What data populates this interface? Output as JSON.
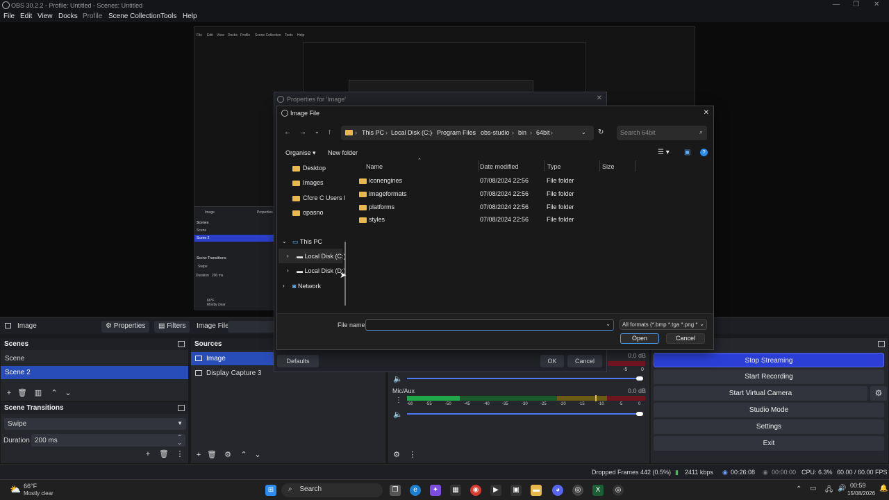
{
  "window": {
    "title": "OBS 30.2.2 - Profile: Untitled - Scenes: Untitled",
    "minimize": "—",
    "maximize": "❐",
    "close": "✕"
  },
  "menu": [
    "File",
    "Edit",
    "View",
    "Docks",
    "Profile",
    "Scene Collection",
    "Tools",
    "Help"
  ],
  "nested_preview": {
    "menu": [
      "File",
      "Edit",
      "View",
      "Docks",
      "Profile",
      "Scene Collection",
      "Tools",
      "Help"
    ],
    "sidebar": {
      "source": "Image",
      "properties": "Properties",
      "scenes_header": "Scenes",
      "scene1": "Scene",
      "scene2": "Scene 2",
      "transitions_header": "Scene Transitions",
      "transition": "Swipe",
      "duration": "Duration",
      "duration_value": "200 ms",
      "weather_temp": "66°F",
      "weather_cond": "Mostly clear"
    }
  },
  "source_toolbar": {
    "source_name": "Image",
    "properties": "Properties",
    "filters": "Filters",
    "image_file": "Image File"
  },
  "scenes": {
    "header": "Scenes",
    "items": [
      "Scene",
      "Scene 2"
    ]
  },
  "sources": {
    "header": "Sources",
    "items": [
      "Image",
      "Display Capture 3"
    ]
  },
  "transitions": {
    "header": "Scene Transitions",
    "type": "Swipe",
    "duration_label": "Duration",
    "duration_value": "200 ms"
  },
  "mixer": {
    "channel1_db": "0.0 dB",
    "channel2_name": "Mic/Aux",
    "channel2_db": "0.0 dB",
    "ticks": [
      "-60",
      "-55",
      "-50",
      "-45",
      "-40",
      "-35",
      "-30",
      "-25",
      "-20",
      "-15",
      "-10",
      "-5",
      "0"
    ],
    "ch1_ticks": [
      "-5",
      "0"
    ]
  },
  "controls": {
    "stop_streaming": "Stop Streaming",
    "start_recording": "Start Recording",
    "start_virtual_camera": "Start Virtual Camera",
    "studio_mode": "Studio Mode",
    "settings": "Settings",
    "exit": "Exit"
  },
  "status": {
    "dropped_frames": "Dropped Frames 442 (0.5%)",
    "bitrate": "2411 kbps",
    "stream_time": "00:26:08",
    "rec_time": "00:00:00",
    "cpu": "CPU: 6.3%",
    "fps": "60.00 / 60.00 FPS"
  },
  "properties_dialog": {
    "title": "Properties for 'Image'",
    "defaults": "Defaults",
    "ok": "OK",
    "cancel": "Cancel"
  },
  "file_dialog": {
    "title": "Image File",
    "breadcrumb": [
      "This PC",
      "Local Disk (C:)",
      "Program Files",
      "obs-studio",
      "bin",
      "64bit"
    ],
    "search_placeholder": "Search 64bit",
    "organise": "Organise",
    "new_folder": "New folder",
    "nav_items": [
      "Desktop",
      "Images",
      "Cfcre C Users l",
      "opasno"
    ],
    "this_pc": "This PC",
    "drive_c": "Local Disk (C:)",
    "drive_d": "Local Disk (D:)",
    "network": "Network",
    "columns": [
      "Name",
      "Date modified",
      "Type",
      "Size"
    ],
    "files": [
      {
        "name": "iconengines",
        "date": "07/08/2024 22:56",
        "type": "File folder"
      },
      {
        "name": "imageformats",
        "date": "07/08/2024 22:56",
        "type": "File folder"
      },
      {
        "name": "platforms",
        "date": "07/08/2024 22:56",
        "type": "File folder"
      },
      {
        "name": "styles",
        "date": "07/08/2024 22:56",
        "type": "File folder"
      }
    ],
    "file_name_label": "File name:",
    "file_name_value": "",
    "filter": "All formats (*.bmp *.tga *.png *",
    "open": "Open",
    "cancel": "Cancel"
  },
  "taskbar": {
    "weather_temp": "66°F",
    "weather_cond": "Mostly clear",
    "search": "Search",
    "time": "00:59",
    "date": "15/08/2026"
  }
}
